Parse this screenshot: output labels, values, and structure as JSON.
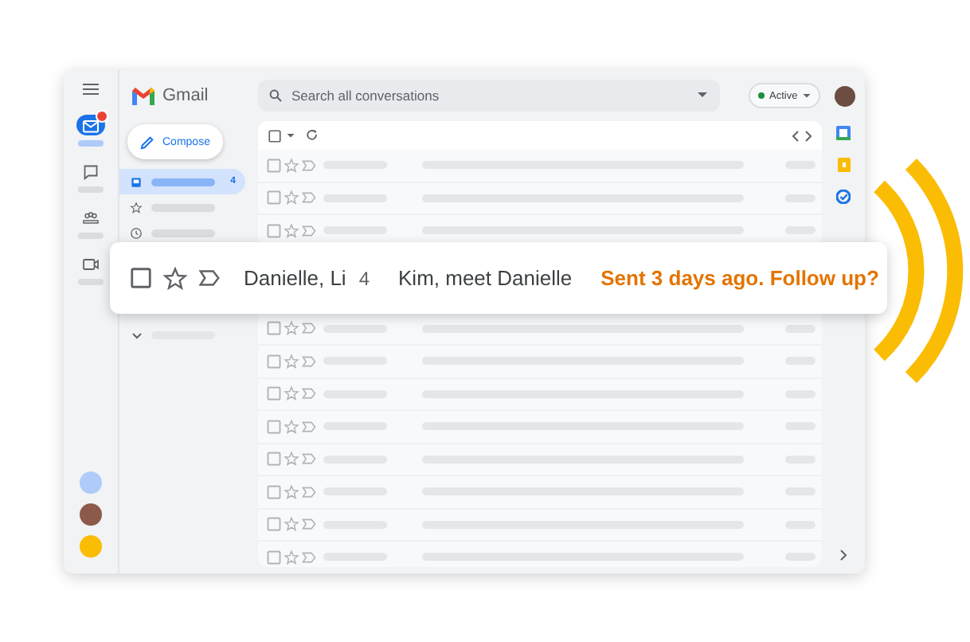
{
  "app": {
    "name": "Gmail"
  },
  "search": {
    "placeholder": "Search all conversations"
  },
  "status": {
    "label": "Active",
    "color": "#1e8e3e"
  },
  "compose": {
    "label": "Compose"
  },
  "rail": [
    {
      "kind": "mail",
      "selected": true,
      "badge": true
    },
    {
      "kind": "chat",
      "selected": false,
      "badge": false
    },
    {
      "kind": "spaces",
      "selected": false,
      "badge": false
    },
    {
      "kind": "meet",
      "selected": false,
      "badge": false
    }
  ],
  "nav": [
    {
      "kind": "inbox",
      "selected": true,
      "count": "4"
    },
    {
      "kind": "starred",
      "selected": false
    },
    {
      "kind": "snoozed",
      "selected": false
    }
  ],
  "highlight": {
    "checked": false,
    "starred": false,
    "sender": "Danielle, Li",
    "count": "4",
    "subject": "Kim, meet Danielle",
    "nudge": "Sent 3 days ago. Follow up?"
  }
}
